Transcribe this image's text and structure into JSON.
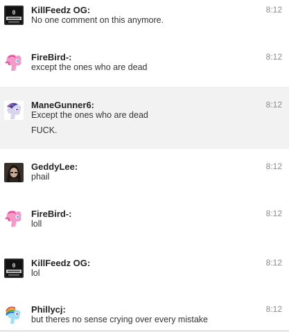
{
  "messages": [
    {
      "author": "KillFeedz OG:",
      "time": "8:12",
      "lines": [
        "No one comment on this anymore."
      ],
      "avatar_icon": "black-ops-logo-icon"
    },
    {
      "author": "FireBird-:",
      "time": "8:12",
      "lines": [
        "except the ones who are dead"
      ],
      "avatar_icon": "pink-pony-icon"
    },
    {
      "author": "ManeGunner6:",
      "time": "8:12",
      "lines": [
        "Except the ones who are dead",
        "FUCK."
      ],
      "avatar_icon": "purple-pony-icon",
      "highlighted": true
    },
    {
      "author": "GeddyLee:",
      "time": "8:12",
      "lines": [
        "phail"
      ],
      "avatar_icon": "person-photo-icon"
    },
    {
      "author": "FireBird-:",
      "time": "8:12",
      "lines": [
        "loll"
      ],
      "avatar_icon": "pink-pony-icon"
    },
    {
      "author": "KillFeedz OG:",
      "time": "8:12",
      "lines": [
        "lol"
      ],
      "avatar_icon": "black-ops-logo-icon"
    },
    {
      "author": "Phillycj:",
      "time": "8:12",
      "lines": [
        "but theres no sense crying over every mistake"
      ],
      "avatar_icon": "rainbow-pony-icon"
    }
  ],
  "colors": {
    "highlight_background": "#f2f2f2",
    "author_text": "#222222",
    "timestamp_text": "#8a8a8a"
  }
}
